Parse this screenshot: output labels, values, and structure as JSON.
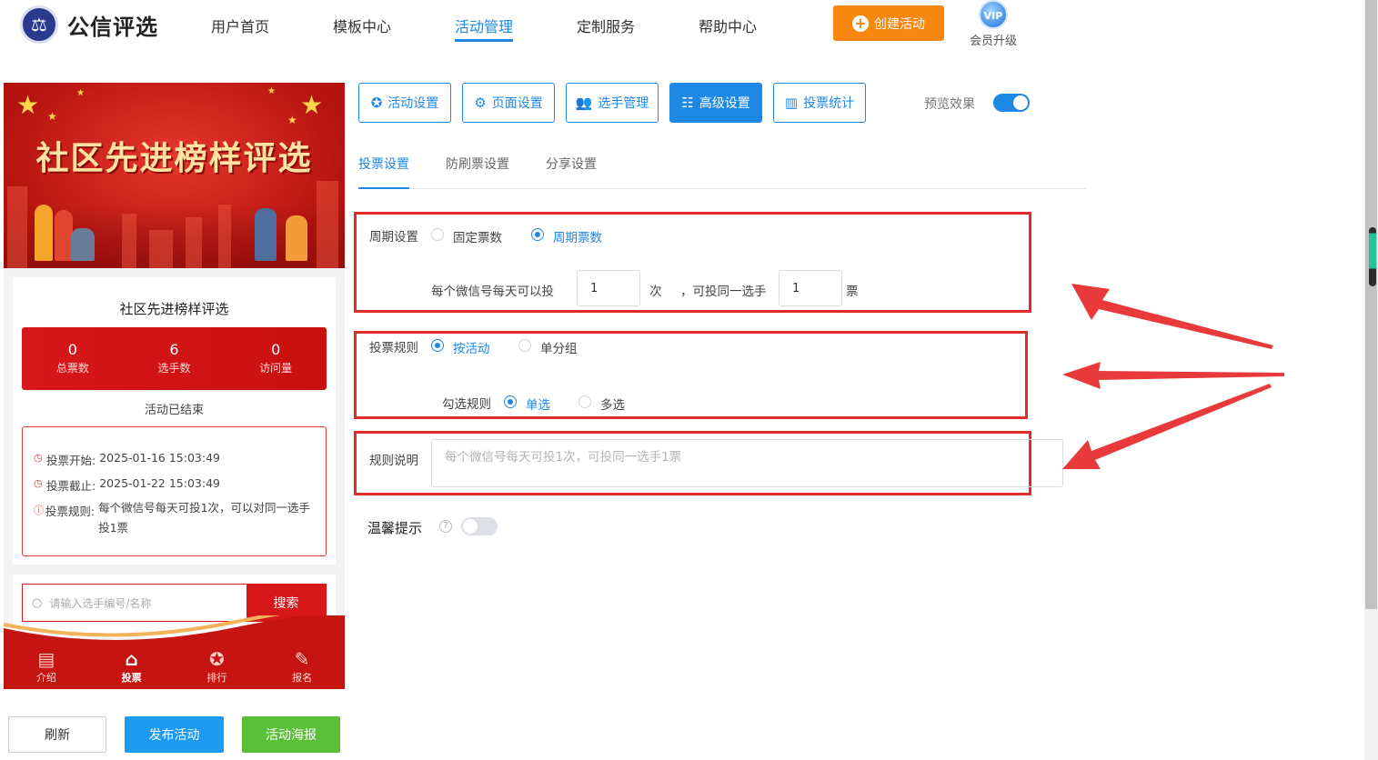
{
  "app": {
    "logo_text": "公信评选"
  },
  "nav": {
    "items": [
      {
        "label": "用户首页",
        "active": false
      },
      {
        "label": "模板中心",
        "active": false
      },
      {
        "label": "活动管理",
        "active": true
      },
      {
        "label": "定制服务",
        "active": false
      },
      {
        "label": "帮助中心",
        "active": false
      }
    ],
    "create_button": "创建活动",
    "vip_badge": "VIP",
    "vip_label": "会员升级"
  },
  "preview": {
    "banner_title": "社区先进榜样评选",
    "activity_title": "社区先进榜样评选",
    "stats": [
      {
        "value": "0",
        "label": "总票数"
      },
      {
        "value": "6",
        "label": "选手数"
      },
      {
        "value": "0",
        "label": "访问量"
      }
    ],
    "status": "活动已结束",
    "info": {
      "start_key": "投票开始:",
      "start_value": "2025-01-16 15:03:49",
      "end_key": "投票截止:",
      "end_value": "2025-01-22 15:03:49",
      "rule_key": "投票规则:",
      "rule_value": "每个微信号每天可投1次，可以对同一选手投1票"
    },
    "search_placeholder": "请输入选手编号/名称",
    "search_button": "搜索",
    "tabbar": [
      {
        "label": "介绍",
        "icon": "book-icon",
        "active": false
      },
      {
        "label": "投票",
        "icon": "home-icon",
        "active": true
      },
      {
        "label": "排行",
        "icon": "rank-badge-icon",
        "active": false
      },
      {
        "label": "报名",
        "icon": "signup-edit-icon",
        "active": false
      }
    ]
  },
  "bottom_buttons": {
    "refresh": "刷新",
    "publish": "发布活动",
    "poster": "活动海报"
  },
  "toolbar": {
    "buttons": [
      {
        "label": "活动设置",
        "icon": "star-icon",
        "active": false
      },
      {
        "label": "页面设置",
        "icon": "gear-icon",
        "active": false
      },
      {
        "label": "选手管理",
        "icon": "users-icon",
        "active": false
      },
      {
        "label": "高级设置",
        "icon": "advanced-settings-icon",
        "active": true
      },
      {
        "label": "投票统计",
        "icon": "bar-chart-icon",
        "active": false
      }
    ],
    "preview_label": "预览效果",
    "preview_enabled": true
  },
  "subtabs": [
    {
      "label": "投票设置",
      "active": true
    },
    {
      "label": "防刷票设置",
      "active": false
    },
    {
      "label": "分享设置",
      "active": false
    }
  ],
  "settings": {
    "cycle": {
      "label": "周期设置",
      "options": [
        {
          "label": "固定票数",
          "selected": false
        },
        {
          "label": "周期票数",
          "selected": true
        }
      ],
      "per_day_prefix": "每个微信号每天可以投",
      "per_day_value": "1",
      "per_day_unit": "次",
      "same_player_prefix": "，可投同一选手",
      "same_player_value": "1",
      "same_player_unit": "票"
    },
    "vote_rule": {
      "label": "投票规则",
      "options": [
        {
          "label": "按活动",
          "selected": true
        },
        {
          "label": "单分组",
          "selected": false
        }
      ],
      "check_label": "勾选规则",
      "check_options": [
        {
          "label": "单选",
          "selected": true
        },
        {
          "label": "多选",
          "selected": false
        }
      ]
    },
    "rule_desc": {
      "label": "规则说明",
      "placeholder": "每个微信号每天可投1次，可投同一选手1票"
    },
    "tip": {
      "label": "温馨提示",
      "enabled": false
    }
  },
  "colors": {
    "accent": "#1e88e5",
    "create": "#f7870f",
    "brand_red": "#d8171a",
    "annotation_red": "#e02b2b",
    "publish": "#1e9af2",
    "poster": "#5bbf3a"
  }
}
